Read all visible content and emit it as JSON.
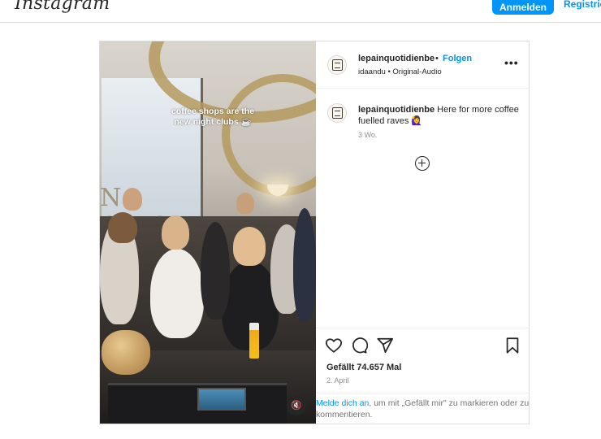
{
  "topbar": {
    "logo_text": "Instagram",
    "login_label": "Anmelden",
    "register_label": "Registrier"
  },
  "post": {
    "username": "lepainquotidienbe",
    "separator": "•",
    "follow_label": "Folgen",
    "subtitle": "idaandu • Original-Audio",
    "more_label": "•••",
    "media": {
      "overlay_text": "coffee shops are the new night clubs ☕",
      "mute_icon_glyph": "🔇"
    },
    "caption": {
      "username": "lepainquotidienbe",
      "text": " Here for more coffee fuelled raves 🙋‍♀️",
      "age": "3 Wo."
    },
    "actions": {
      "like_icon": "heart-icon",
      "comment_icon": "comment-icon",
      "share_icon": "share-icon",
      "save_icon": "bookmark-icon"
    },
    "likes_text": "Gefällt 74.657 Mal",
    "date_text": "2. April",
    "login_prompt": {
      "link_text": "Melde dich an",
      "rest_text": ", um mit „Gefällt mir\" zu markieren oder zu kommentieren."
    }
  },
  "colors": {
    "accent": "#0095f6",
    "text": "#262626",
    "muted": "#8e8e8e",
    "border": "#dbdbdb"
  }
}
